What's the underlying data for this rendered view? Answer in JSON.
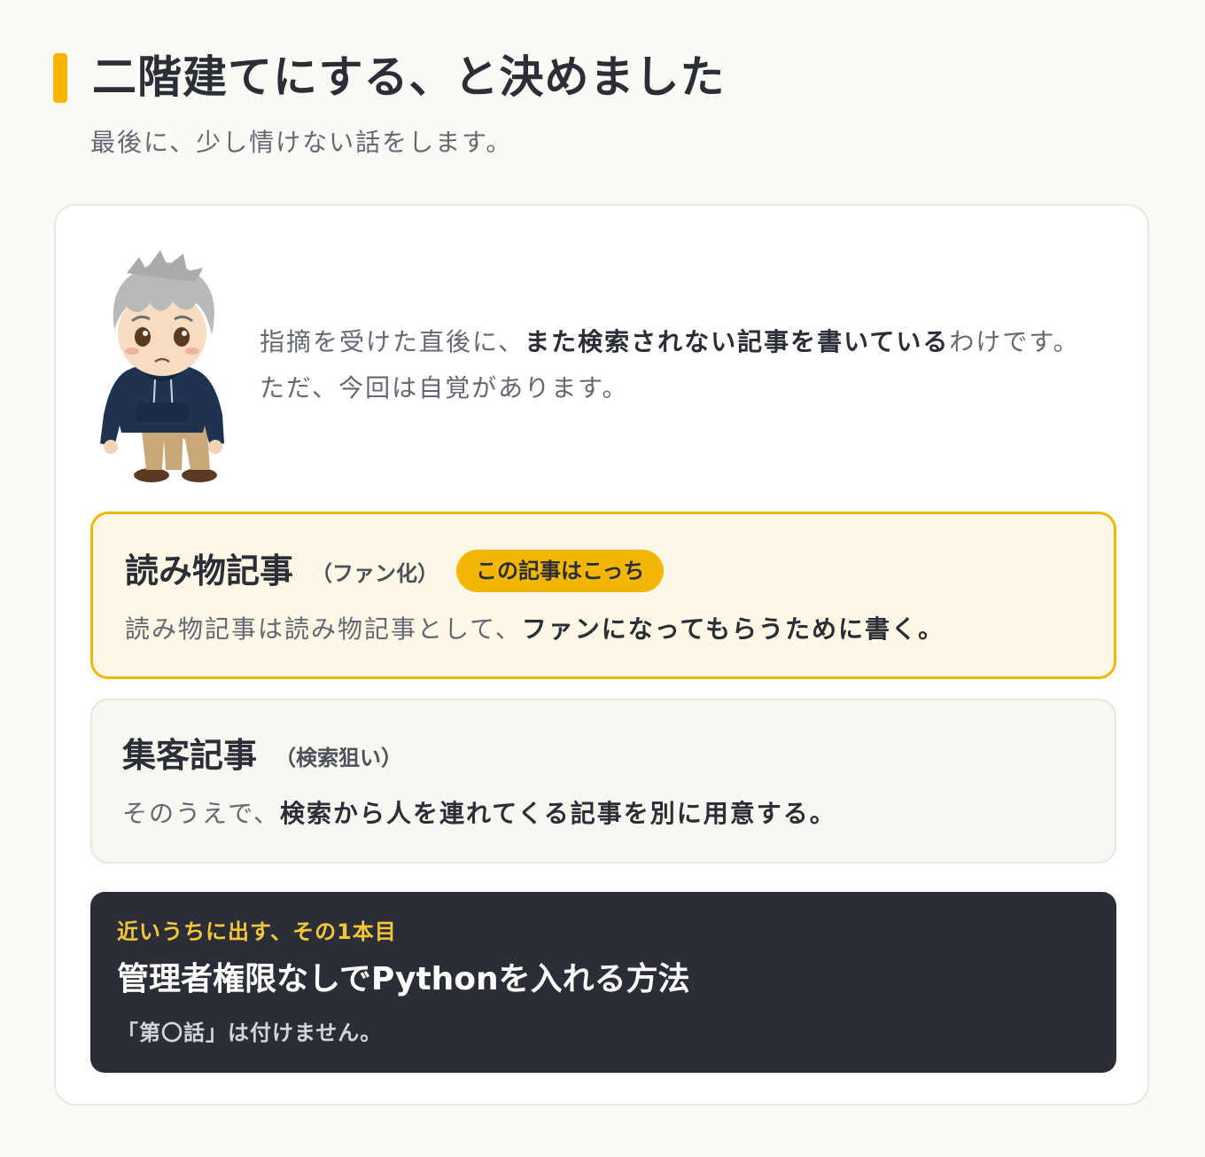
{
  "header": {
    "title": "二階建てにする、と決めました",
    "subtitle": "最後に、少し情けない話をします。"
  },
  "intro": {
    "text_before": "指摘を受けた直後に、",
    "text_bold": "また検索されない記事を書いている",
    "text_after": "わけです。",
    "line2": "ただ、今回は自覚があります。"
  },
  "options": {
    "fan": {
      "title": "読み物記事",
      "note": "（ファン化）",
      "badge": "この記事はこっち",
      "body_plain": "読み物記事は読み物記事として、",
      "body_bold": "ファンになってもらうために書く。"
    },
    "seo": {
      "title": "集客記事",
      "note": "（検索狙い）",
      "body_plain": "そのうえで、",
      "body_bold": "検索から人を連れてくる記事を別に用意する。"
    }
  },
  "next": {
    "kicker": "近いうちに出す、その1本目",
    "title": "管理者権限なしでPythonを入れる方法",
    "note": "「第〇話」は付けません。"
  },
  "colors": {
    "accent": "#f2b705",
    "dark": "#2b2e36",
    "kicker": "#f5c73a",
    "background": "#fbfaf6"
  }
}
